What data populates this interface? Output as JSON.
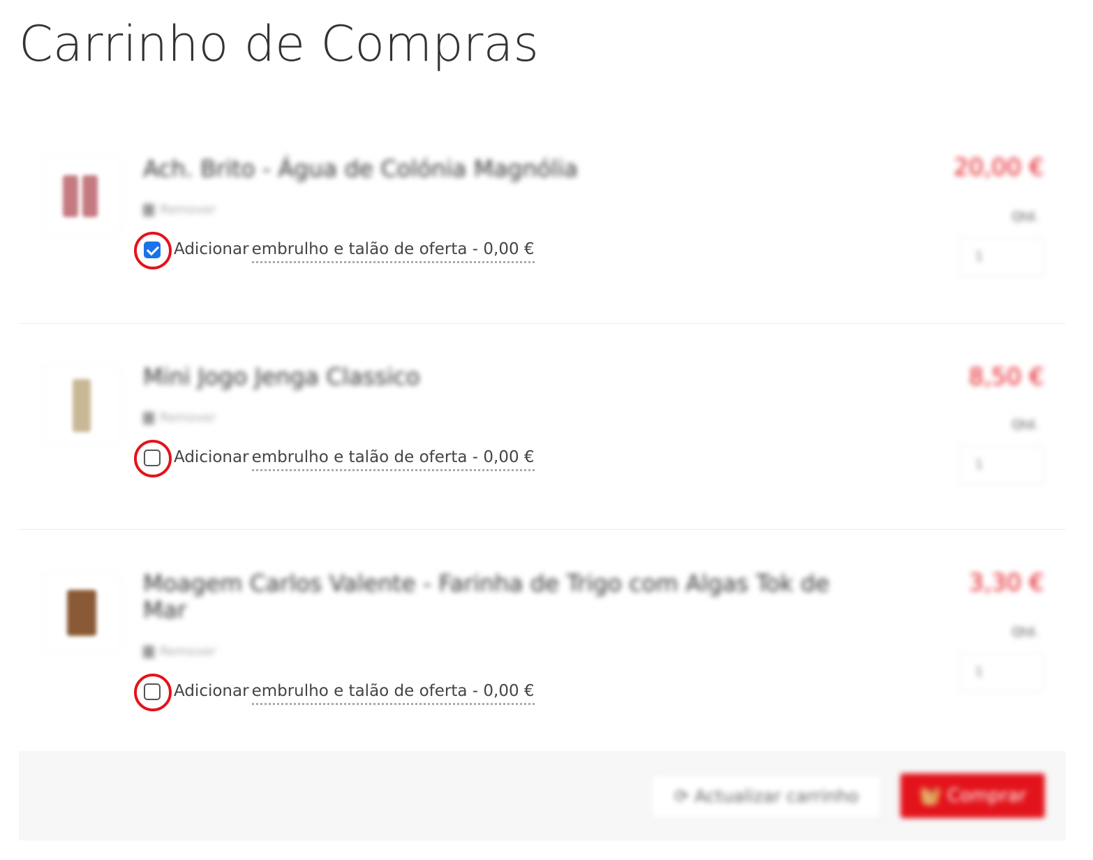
{
  "page": {
    "title": "Carrinho de Compras"
  },
  "items": [
    {
      "name": "Ach. Brito - Água de Colónia Magnólia",
      "remove_label": "Remover",
      "gift_label": "Adicionar",
      "gift_detail": "embrulho e talão de oferta - 0,00 €",
      "gift_checked": true,
      "price": "20,00 €",
      "qty_label": "Qtd.",
      "qty_value": "1"
    },
    {
      "name": "Mini Jogo Jenga Classico",
      "remove_label": "Remover",
      "gift_label": "Adicionar",
      "gift_detail": "embrulho e talão de oferta - 0,00 €",
      "gift_checked": false,
      "price": "8,50 €",
      "qty_label": "Qtd.",
      "qty_value": "1"
    },
    {
      "name": "Moagem Carlos Valente - Farinha de Trigo com Algas Tok de Mar",
      "remove_label": "Remover",
      "gift_label": "Adicionar",
      "gift_detail": "embrulho e talão de oferta - 0,00 €",
      "gift_checked": false,
      "price": "3,30 €",
      "qty_label": "Qtd.",
      "qty_value": "1"
    }
  ],
  "footer": {
    "update_label": "Actualizar carrinho",
    "buy_label": "Comprar",
    "update_icon": "refresh-icon",
    "buy_icon": "basket-icon"
  },
  "colors": {
    "accent": "#e3131b",
    "checkbox_checked": "#1a73e8",
    "highlight_ring": "#e3131b"
  }
}
